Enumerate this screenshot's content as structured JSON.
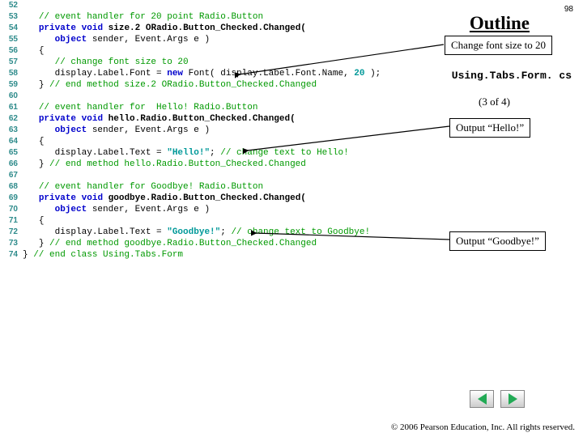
{
  "slide_number": "98",
  "outline_title": "Outline",
  "filename": "Using.Tabs.Form. cs",
  "page_of": "(3 of 4)",
  "callouts": {
    "font20": "Change font size to 20",
    "hello": "Output “Hello!”",
    "goodbye": "Output “Goodbye!”"
  },
  "copyright": "© 2006 Pearson Education, Inc.  All rights reserved.",
  "code": {
    "l52": {
      "n": "52"
    },
    "l53": {
      "n": "53",
      "comment": "// event handler for 20 point Radio.Button"
    },
    "l54": {
      "n": "54",
      "kw1": "private",
      "kw2": "void",
      "fn": "size.2 ORadio.Button_Checked.Changed("
    },
    "l55": {
      "n": "55",
      "kw": "object",
      "rest": " sender, Event.Args e )"
    },
    "l56": {
      "n": "56",
      "brace": "{"
    },
    "l57": {
      "n": "57",
      "comment": "// change font size to 20"
    },
    "l58": {
      "n": "58",
      "lhs": "display.Label.Font = ",
      "kw": "new",
      "mid": " Font( display.Label.Font.Name, ",
      "num": "20",
      "end": " );"
    },
    "l59": {
      "n": "59",
      "brace": "} ",
      "comment": "// end method size.2 ORadio.Button_Checked.Changed"
    },
    "l60": {
      "n": "60"
    },
    "l61": {
      "n": "61",
      "comment": "// event handler for  Hello! Radio.Button"
    },
    "l62": {
      "n": "62",
      "kw1": "private",
      "kw2": "void",
      "fn": "hello.Radio.Button_Checked.Changed("
    },
    "l63": {
      "n": "63",
      "kw": "object",
      "rest": " sender, Event.Args e )"
    },
    "l64": {
      "n": "64",
      "brace": "{"
    },
    "l65": {
      "n": "65",
      "lhs": "display.Label.Text = ",
      "str": "\"Hello!\"",
      "end": "; ",
      "comment": "// change text to Hello!"
    },
    "l66": {
      "n": "66",
      "brace": "} ",
      "comment": "// end method hello.Radio.Button_Checked.Changed"
    },
    "l67": {
      "n": "67"
    },
    "l68": {
      "n": "68",
      "comment": "// event handler for Goodbye! Radio.Button"
    },
    "l69": {
      "n": "69",
      "kw1": "private",
      "kw2": "void",
      "fn": "goodbye.Radio.Button_Checked.Changed("
    },
    "l70": {
      "n": "70",
      "kw": "object",
      "rest": " sender, Event.Args e )"
    },
    "l71": {
      "n": "71",
      "brace": "{"
    },
    "l72": {
      "n": "72",
      "lhs": "display.Label.Text = ",
      "str": "\"Goodbye!\"",
      "end": "; ",
      "comment": "// change text to Goodbye!"
    },
    "l73": {
      "n": "73",
      "brace": "} ",
      "comment": "// end method goodbye.Radio.Button_Checked.Changed"
    },
    "l74": {
      "n": "74",
      "brace": "} ",
      "comment": "// end class Using.Tabs.Form"
    }
  }
}
